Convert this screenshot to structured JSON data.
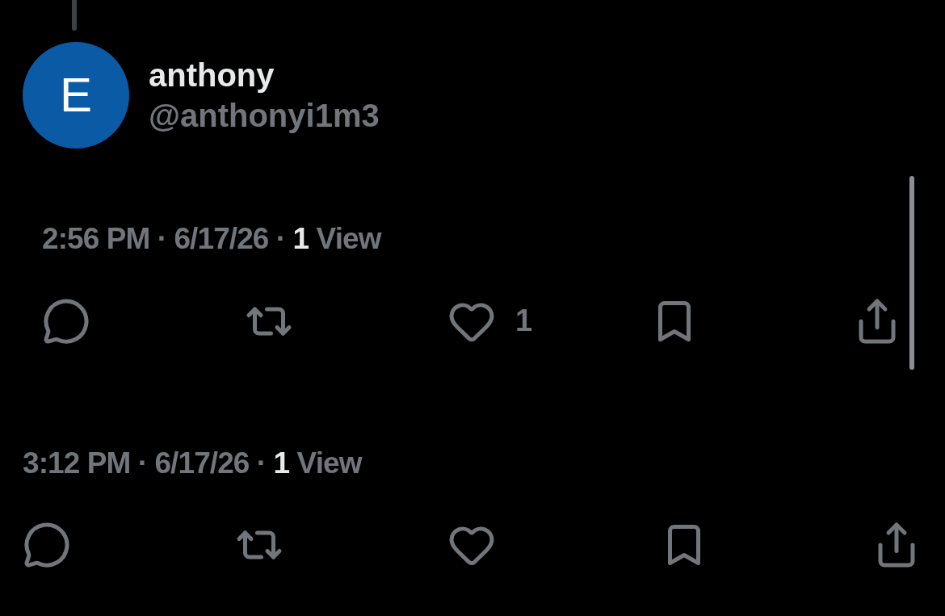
{
  "author": {
    "avatar_letter": "E",
    "name": "anthony",
    "handle": "@anthonyi1m3"
  },
  "posts": [
    {
      "timestamp": "2:56 PM · 6/17/26 ·",
      "views_count": "1",
      "views_label": "View",
      "actions": [
        {
          "kind": "reply"
        },
        {
          "kind": "repost"
        },
        {
          "kind": "like",
          "count": "1"
        },
        {
          "kind": "bookmark"
        },
        {
          "kind": "share"
        }
      ]
    },
    {
      "timestamp": "3:12 PM · 6/17/26 ·",
      "views_count": "1",
      "views_label": "View",
      "actions": [
        {
          "kind": "reply"
        },
        {
          "kind": "repost"
        },
        {
          "kind": "like"
        },
        {
          "kind": "bookmark"
        },
        {
          "kind": "share"
        }
      ]
    }
  ]
}
